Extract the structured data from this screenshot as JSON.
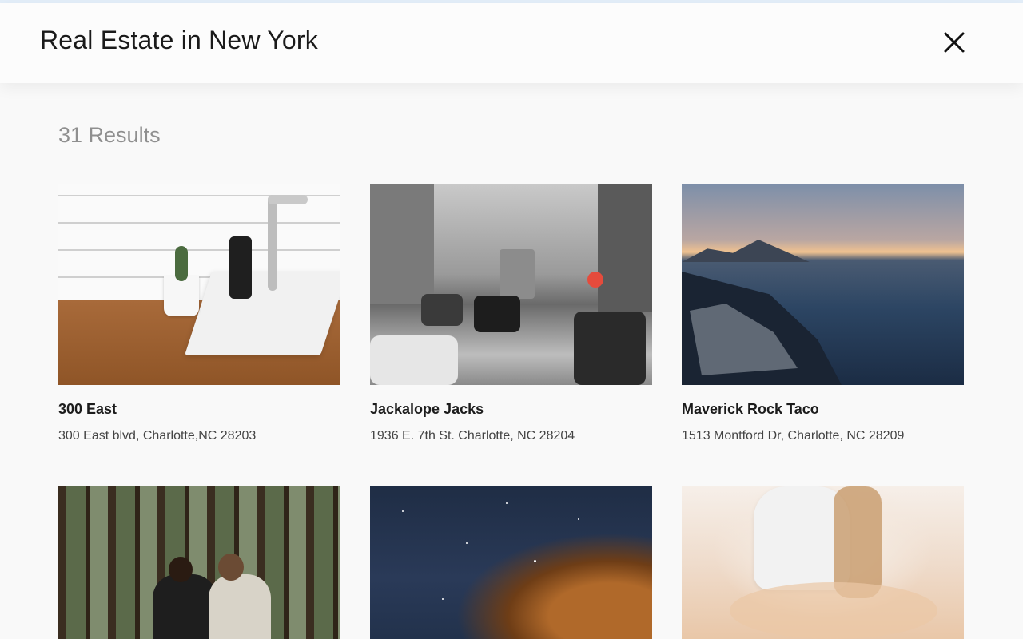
{
  "header": {
    "title": "Real Estate in New York",
    "close_icon": "close-icon"
  },
  "results": {
    "count_label": "31 Results"
  },
  "listings": [
    {
      "name": "300 East",
      "address": "300 East blvd, Charlotte,NC 28203",
      "image": "kitchen-sink-photo"
    },
    {
      "name": "Jackalope Jacks",
      "address": "1936 E. 7th St. Charlotte, NC 28204",
      "image": "city-street-photo"
    },
    {
      "name": "Maverick Rock Taco",
      "address": "1513 Montford Dr, Charlotte, NC 28209",
      "image": "rocky-coast-photo"
    },
    {
      "name": "",
      "address": "",
      "image": "forest-couple-photo"
    },
    {
      "name": "",
      "address": "",
      "image": "night-sky-photo"
    },
    {
      "name": "",
      "address": "",
      "image": "beach-woman-photo"
    }
  ],
  "colors": {
    "accent_bar": "#e3eef9",
    "header_bg": "#fcfcfc",
    "page_bg": "#f9f9f9",
    "muted_text": "#8f8f8f"
  }
}
